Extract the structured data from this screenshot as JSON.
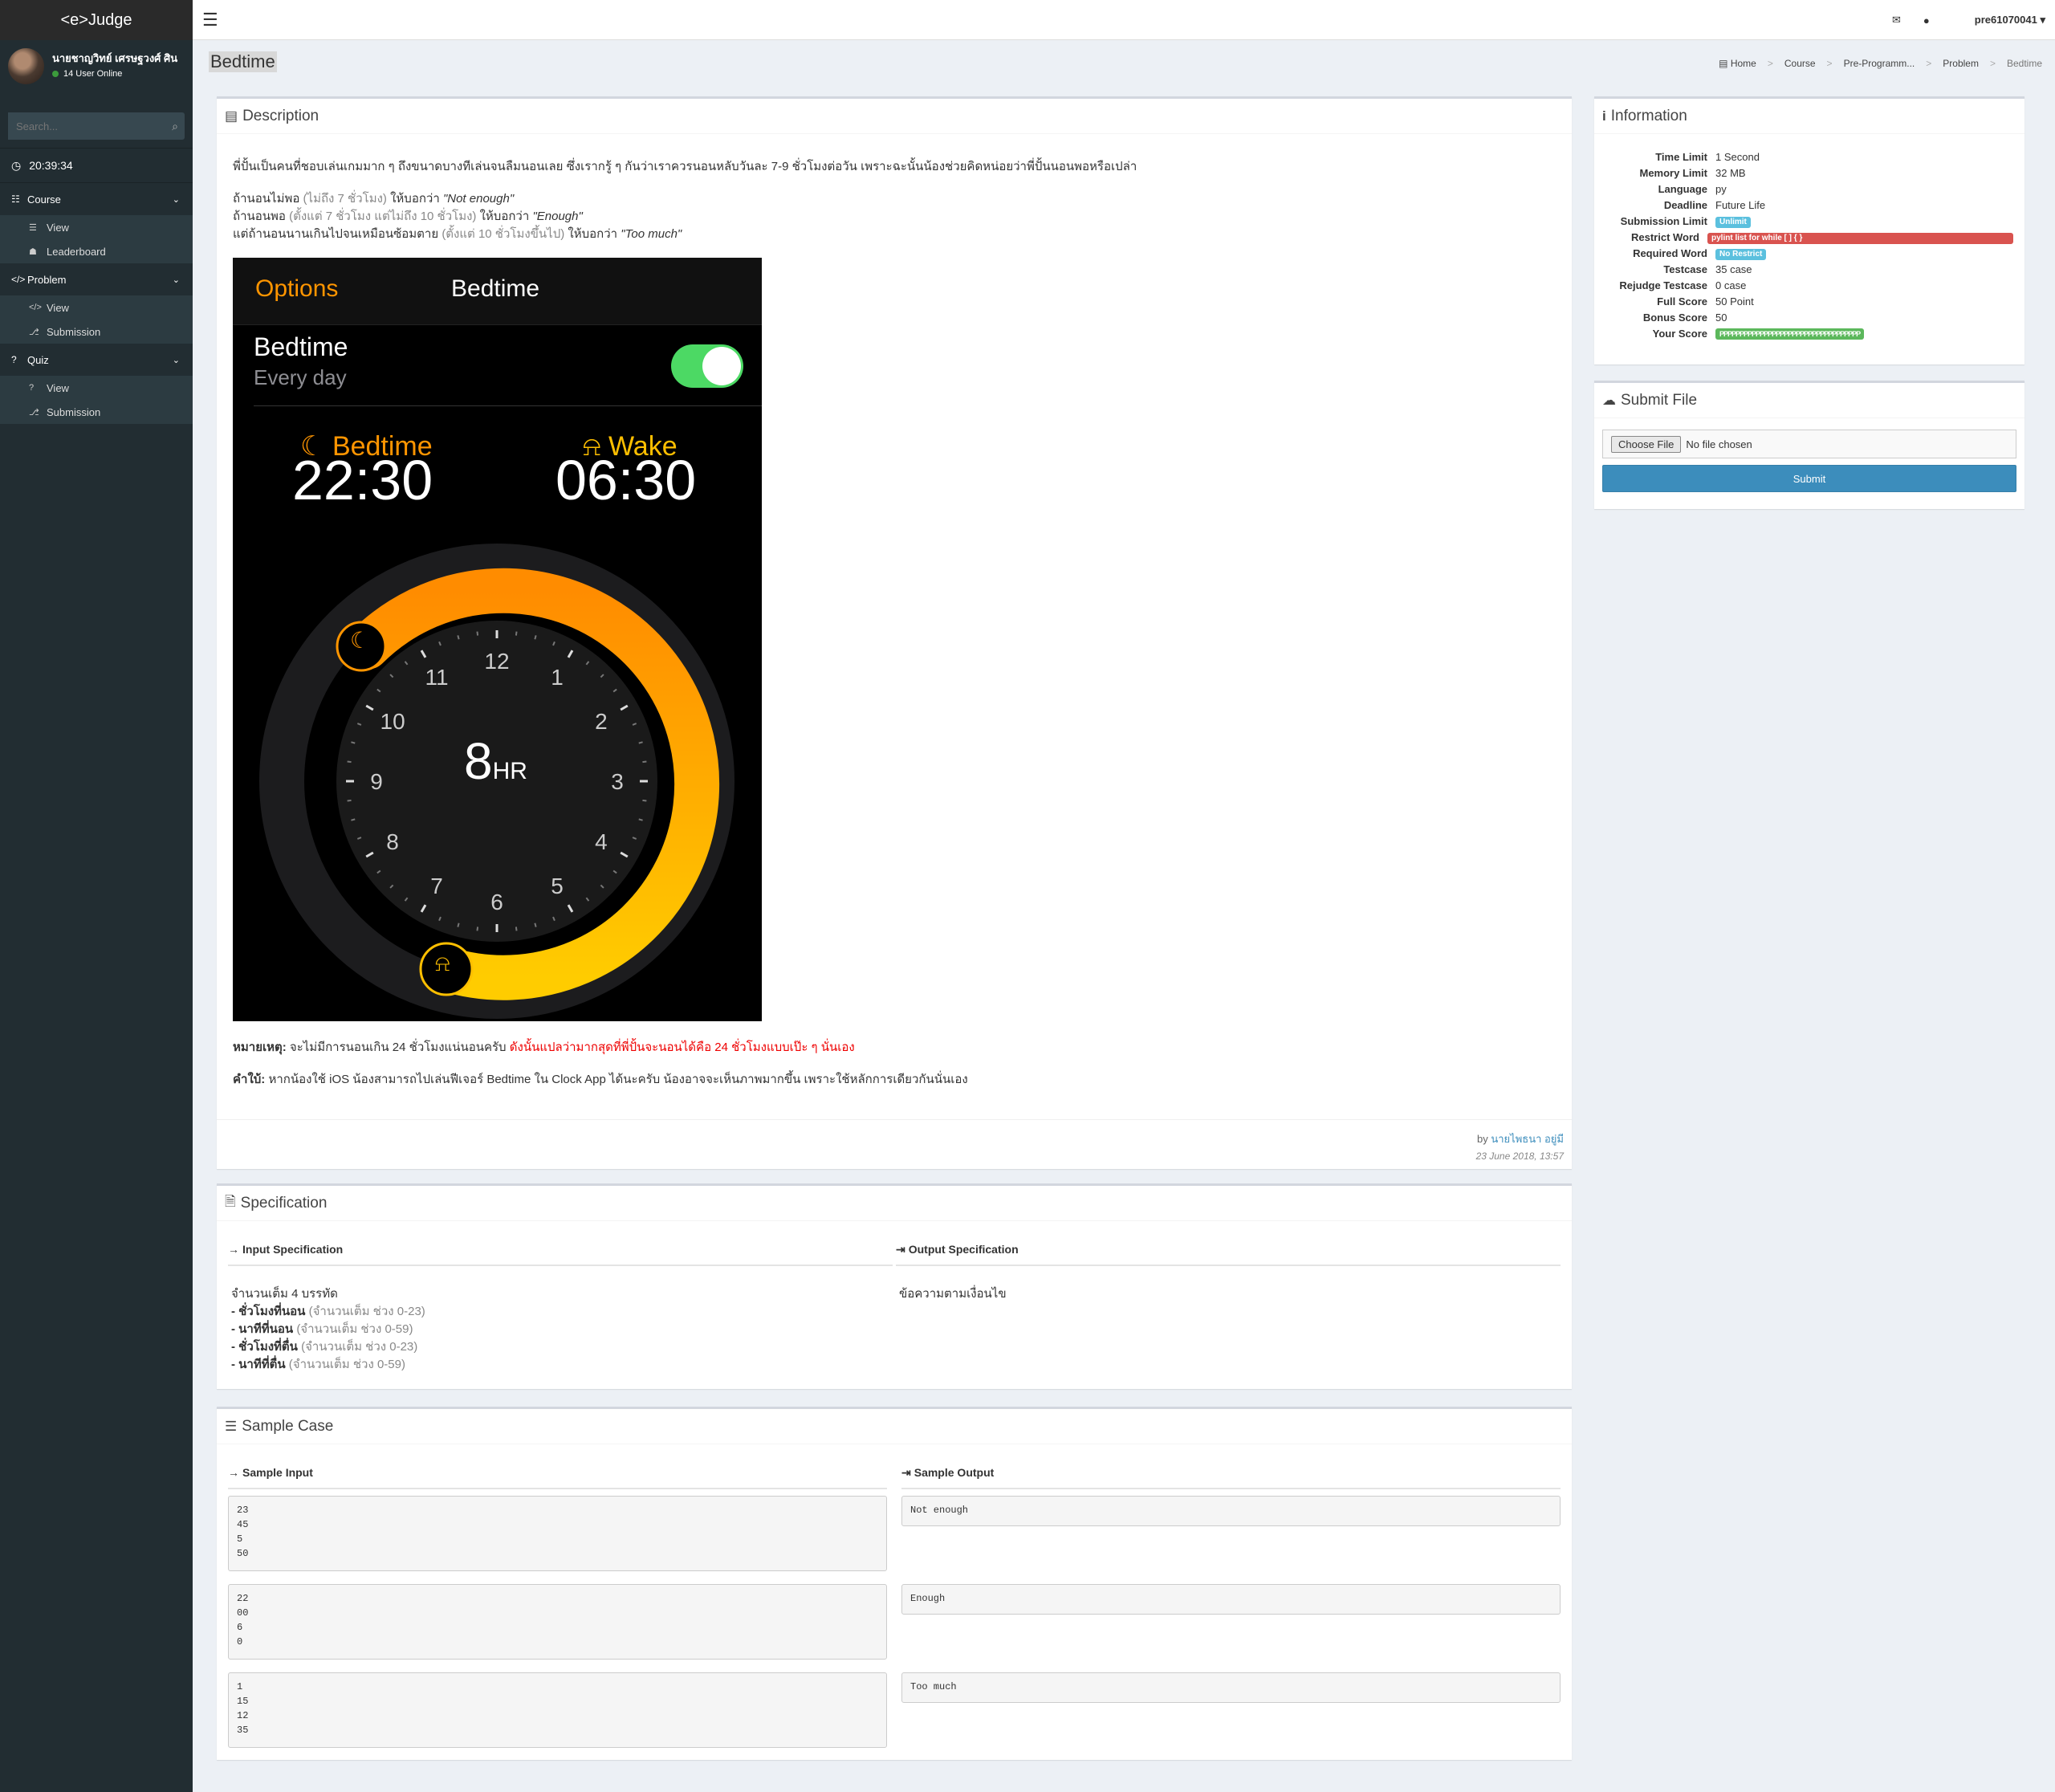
{
  "app": {
    "logo": "<e>Judge",
    "clock": "20:39:34"
  },
  "user": {
    "name": "นายชาญวิทย์ เศรษฐวงศ์ ศิน",
    "online": "14 User Online",
    "username": "pre61070041"
  },
  "search": {
    "placeholder": "Search..."
  },
  "nav": {
    "course": {
      "label": "Course",
      "items": [
        "View",
        "Leaderboard"
      ]
    },
    "problem": {
      "label": "Problem",
      "items": [
        "View",
        "Submission"
      ]
    },
    "quiz": {
      "label": "Quiz",
      "items": [
        "View",
        "Submission"
      ]
    }
  },
  "page": {
    "title": "Bedtime"
  },
  "breadcrumb": [
    "Home",
    "Course",
    "Pre-Programm...",
    "Problem",
    "Bedtime"
  ],
  "description": {
    "heading": "Description",
    "intro": "พี่ปั้นเป็นคนที่ชอบเล่นเกมมาก ๆ ถึงขนาดบางทีเล่นจนลืมนอนเลย ซึ่งเรากรู้ ๆ กันว่าเราควรนอนหลับวันละ 7-9 ชั่วโมงต่อวัน เพราะฉะนั้นน้องช่วยคิดหน่อยว่าพี่ปั้นนอนพอหรือเปล่า",
    "rule1_a": "ถ้านอนไม่พอ",
    "rule1_b": "(ไม่ถึง 7 ชั่วโมง)",
    "rule1_c": "ให้บอกว่า",
    "rule1_d": "\"Not enough\"",
    "rule2_a": "ถ้านอนพอ",
    "rule2_b": "(ตั้งแต่ 7 ชั่วโมง แต่ไม่ถึง 10 ชั่วโมง)",
    "rule2_c": "ให้บอกว่า",
    "rule2_d": "\"Enough\"",
    "rule3_a": "แต่ถ้านอนนานเกินไปจนเหมือนซ้อมตาย",
    "rule3_b": "(ตั้งแต่ 10 ชั่วโมงขึ้นไป)",
    "rule3_c": "ให้บอกว่า",
    "rule3_d": "\"Too much\"",
    "note_label": "หมายเหตุ:",
    "note_text": "จะไม่มีการนอนเกิน 24 ชั่วโมงแน่นอนครับ",
    "note_red": "ดังนั้นแปลว่ามากสุดที่พี่ปั้นจะนอนได้คือ 24 ชั่วโมงแบบเป๊ะ ๆ นั่นเอง",
    "hint_label": "คำใบ้:",
    "hint_text": "หากน้องใช้ iOS น้องสามารถไปเล่นฟีเจอร์ Bedtime ใน Clock App ได้นะครับ น้องอาจจะเห็นภาพมากขึ้น เพราะใช้หลักการเดียวกันนั่นเอง",
    "by": "by",
    "author": "นายไพธนา อยู่มี",
    "date": "23 June 2018, 13:57"
  },
  "phone": {
    "options": "Options",
    "title": "Bedtime",
    "row_title": "Bedtime",
    "row_sub": "Every day",
    "bed_label": "Bedtime",
    "bed_time": "22:30",
    "wake_label": "Wake",
    "wake_time": "06:30",
    "duration": "8",
    "duration_unit": "HR",
    "dial": [
      "12",
      "1",
      "2",
      "3",
      "4",
      "5",
      "6",
      "7",
      "8",
      "9",
      "10",
      "11"
    ],
    "accent": "#ff9500"
  },
  "spec": {
    "heading": "Specification",
    "input_heading": "Input Specification",
    "output_heading": "Output Specification",
    "in_line1": "จำนวนเต็ม 4 บรรทัด",
    "in_items": [
      {
        "b": "- ชั่วโมงที่นอน",
        "g": "(จำนวนเต็ม ช่วง 0-23)"
      },
      {
        "b": "- นาทีที่นอน",
        "g": "(จำนวนเต็ม ช่วง 0-59)"
      },
      {
        "b": "- ชั่วโมงที่ตื่น",
        "g": "(จำนวนเต็ม ช่วง 0-23)"
      },
      {
        "b": "- นาทีที่ตื่น",
        "g": "(จำนวนเต็ม ช่วง 0-59)"
      }
    ],
    "out_text": "ข้อความตามเงื่อนไข"
  },
  "samples": {
    "heading": "Sample Case",
    "input_heading": "Sample Input",
    "output_heading": "Sample Output",
    "cases": [
      {
        "input": "23\n45\n5\n50",
        "output": "Not enough"
      },
      {
        "input": "22\n00\n6\n0",
        "output": "Enough"
      },
      {
        "input": "1\n15\n12\n35",
        "output": "Too much"
      }
    ]
  },
  "info": {
    "heading": "Information",
    "rows": [
      {
        "k": "Time Limit",
        "v": "1 Second"
      },
      {
        "k": "Memory Limit",
        "v": "32 MB"
      },
      {
        "k": "Language",
        "v": "py"
      },
      {
        "k": "Deadline",
        "v": "Future Life"
      },
      {
        "k": "Submission Limit",
        "v": "Unlimit"
      },
      {
        "k": "Restrict Word",
        "v": "pylint list for while [ ] { }"
      },
      {
        "k": "Required Word",
        "v": "No Restrict"
      },
      {
        "k": "Testcase",
        "v": "35 case"
      },
      {
        "k": "Rejudge Testcase",
        "v": "0 case"
      },
      {
        "k": "Full Score",
        "v": "50 Point"
      },
      {
        "k": "Bonus Score",
        "v": "50"
      },
      {
        "k": "Your Score",
        "v": "PPPPPPPPPPPPPPPPPPPPPPPPPPPPPPPPPPP"
      }
    ]
  },
  "submit": {
    "heading": "Submit File",
    "choose": "Choose File",
    "nofile": "No file chosen",
    "button": "Submit"
  },
  "colors": {
    "primary": "#3c8dbc",
    "success": "#5cb85c",
    "danger": "#d9534f",
    "info": "#5bc0de",
    "sidebar": "#222d32"
  }
}
